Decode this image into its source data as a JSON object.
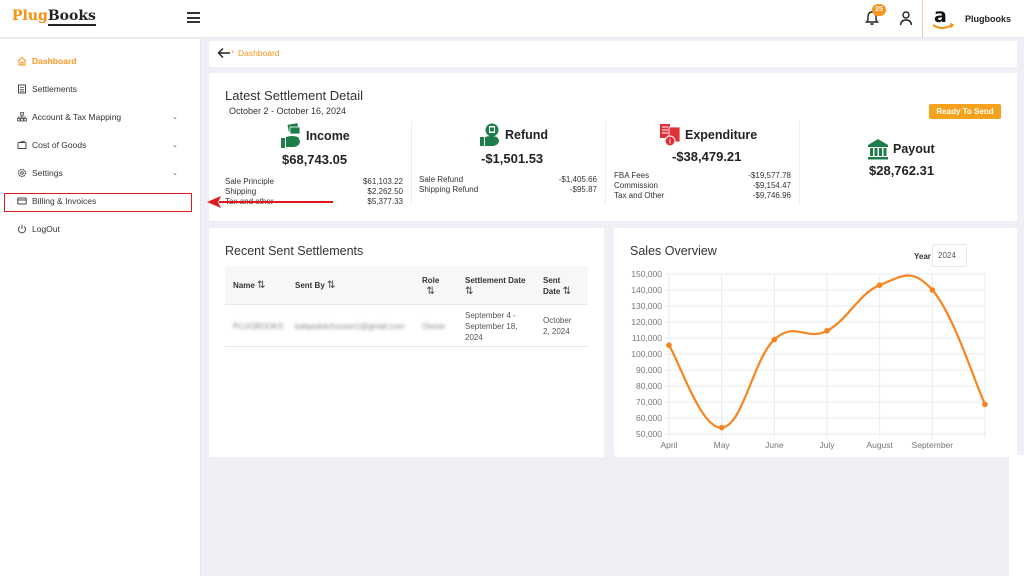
{
  "header": {
    "logo_part1": "Plug",
    "logo_part2": "Books",
    "notification_count": "25",
    "store_name": "Plugbooks",
    "icons": [
      "menu-icon",
      "bell-icon",
      "user-icon",
      "amazon-logo"
    ]
  },
  "sidebar": {
    "items": [
      {
        "label": "Dashboard",
        "icon": "home-icon",
        "active": true,
        "expandable": false
      },
      {
        "label": "Settlements",
        "icon": "document-icon",
        "active": false,
        "expandable": false
      },
      {
        "label": "Account & Tax Mapping",
        "icon": "sitemap-icon",
        "active": false,
        "expandable": true
      },
      {
        "label": "Cost of Goods",
        "icon": "wallet-icon",
        "active": false,
        "expandable": true
      },
      {
        "label": "Settings",
        "icon": "gear-icon",
        "active": false,
        "expandable": true
      },
      {
        "label": "Billing & Invoices",
        "icon": "card-icon",
        "active": false,
        "expandable": false,
        "highlighted": true
      },
      {
        "label": "LogOut",
        "icon": "power-icon",
        "active": false,
        "expandable": false
      }
    ]
  },
  "breadcrumb": {
    "current": "Dashboard"
  },
  "settlement": {
    "title": "Latest Settlement Detail",
    "range": "October 2 - October 16, 2024",
    "status_button": "Ready To Send",
    "income": {
      "label": "Income",
      "total": "$68,743.05",
      "rows": [
        {
          "name": "Sale Principle",
          "value": "$61,103.22"
        },
        {
          "name": "Shipping",
          "value": "$2,262.50"
        },
        {
          "name": "Tax and other",
          "value": "$5,377.33"
        }
      ]
    },
    "refund": {
      "label": "Refund",
      "total": "-$1,501.53",
      "rows": [
        {
          "name": "Sale Refund",
          "value": "-$1,405.66"
        },
        {
          "name": "Shipping Refund",
          "value": "-$95.87"
        }
      ]
    },
    "expenditure": {
      "label": "Expenditure",
      "total": "-$38,479.21",
      "rows": [
        {
          "name": "FBA Fees",
          "value": "-$19,577.78"
        },
        {
          "name": "Commission",
          "value": "-$9,154.47"
        },
        {
          "name": "Tax and Other",
          "value": "-$9,746.96"
        }
      ]
    },
    "payout": {
      "label": "Payout",
      "total": "$28,762.31"
    }
  },
  "recent": {
    "title": "Recent Sent Settlements",
    "columns": [
      {
        "label1": "Name",
        "label2": ""
      },
      {
        "label1": "Sent By",
        "label2": ""
      },
      {
        "label1": "Role",
        "label2": ""
      },
      {
        "label1": "Settlement Date",
        "label2": ""
      },
      {
        "label1": "Sent",
        "label2": "Date"
      }
    ],
    "rows": [
      {
        "name": "PLUGBOOKS",
        "sent_by": "balqaslotchouser1@gmail.com",
        "role": "Owner",
        "settlement_date_1": "September 4 -",
        "settlement_date_2": "September 18,",
        "settlement_date_3": "2024",
        "sent_date_1": "October",
        "sent_date_2": "2, 2024"
      }
    ]
  },
  "sales": {
    "title": "Sales Overview",
    "year_label": "Year",
    "year_value": "2024"
  },
  "chart_data": {
    "type": "line",
    "title": "Sales Overview",
    "categories": [
      "April",
      "May",
      "June",
      "July",
      "August",
      "September",
      ""
    ],
    "series": [
      {
        "name": "Sales",
        "values": [
          105500,
          54000,
          109000,
          114500,
          143000,
          140000,
          68500
        ],
        "color": "#f7841d"
      }
    ],
    "ylim": [
      50000,
      150000
    ],
    "yticks": [
      50000,
      60000,
      70000,
      80000,
      90000,
      100000,
      110000,
      120000,
      130000,
      140000,
      150000
    ],
    "ytick_labels": [
      "50,000",
      "60,000",
      "70,000",
      "80,000",
      "90,000",
      "100,000",
      "110,000",
      "120,000",
      "130,000",
      "140,000",
      "150,000"
    ],
    "grid": true,
    "legend": "none",
    "curve": "smooth"
  },
  "colors": {
    "accent": "#f7941d",
    "green_icon": "#1e7e4a",
    "red_icon": "#e0313b",
    "annotation_red": "#e0191f"
  }
}
